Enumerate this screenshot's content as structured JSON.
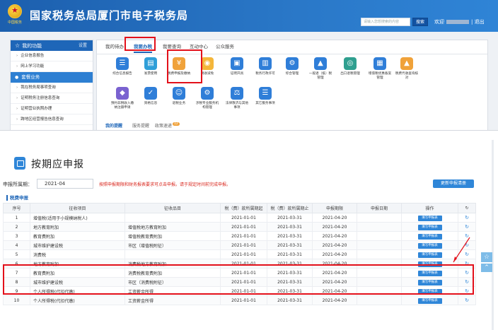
{
  "header": {
    "emblem_text": "中国税务",
    "title": "国家税务总局厦门市电子税务局",
    "search_placeholder": "请输入您想搜索的内容",
    "search_button": "搜索",
    "welcome": "欢迎",
    "logout": "| 退出"
  },
  "sidebar": {
    "head": "我的功能",
    "set": "设置",
    "items_top": [
      "企业信息报告",
      "网上学习功能"
    ],
    "active": "套餐业务",
    "items_bottom": [
      "我在税务局事项查询",
      "证明税务注册信息查询",
      "证明营业执照办理",
      "跨地区经营报告信息查询"
    ]
  },
  "tabs": [
    "我的待办",
    "我要办税",
    "我要查询",
    "互动中心",
    "公众服务"
  ],
  "icons": [
    {
      "label": "综合信息报告",
      "glyph": "☰",
      "color": "#2f7ed8"
    },
    {
      "label": "发票使用",
      "glyph": "▤",
      "color": "#2f9fd8"
    },
    {
      "label": "税费申报及缴纳",
      "glyph": "¥",
      "color": "#f0a23a"
    },
    {
      "label": "税收减免",
      "glyph": "◉",
      "color": "#f4b63a"
    },
    {
      "label": "证明开具",
      "glyph": "▣",
      "color": "#2f7ed8"
    },
    {
      "label": "税务行政许可",
      "glyph": "▥",
      "color": "#2f7ed8"
    },
    {
      "label": "综合管理",
      "glyph": "⚙",
      "color": "#2f7ed8"
    },
    {
      "label": "一般退（抵）税管理",
      "glyph": "▲",
      "color": "#2f7ed8"
    },
    {
      "label": "出口退税管理",
      "glyph": "◎",
      "color": "#2f9f8f"
    },
    {
      "label": "增值税优惠备案管理",
      "glyph": "▦",
      "color": "#2f7ed8"
    },
    {
      "label": "税费代收查询核对",
      "glyph": "▲",
      "color": "#f0a23a"
    },
    {
      "label": "预约非税收入缴纳注册申请",
      "glyph": "◆",
      "color": "#7a62d0"
    },
    {
      "label": "资格信息",
      "glyph": "✓",
      "color": "#2f7ed8"
    },
    {
      "label": "退税业务",
      "glyph": "☺",
      "color": "#2f7ed8"
    },
    {
      "label": "涉税专业服务机构管理",
      "glyph": "⚙",
      "color": "#2f7ed8"
    },
    {
      "label": "法律救济与其他事项",
      "glyph": "⚖",
      "color": "#2f7ed8"
    },
    {
      "label": "其它服务事项",
      "glyph": "☰",
      "color": "#2f7ed8"
    }
  ],
  "panel_footer": {
    "links": [
      "我的提醒",
      "服务提醒",
      "政策速递"
    ],
    "count": "12"
  },
  "page": {
    "title": "按期应申报",
    "period_label": "申报所属期：",
    "period_value": "2021-04",
    "notice": "按照申报期限和财务报表要求可点击申报。请于规定时间前完成申报。",
    "refresh_button": "更新申报清册",
    "section_title": "税费申报"
  },
  "table": {
    "columns": [
      "序号",
      "征收项目",
      "征收品目",
      "税（费）款所属期起",
      "税（费）款所属期止",
      "申报期限",
      "申报日期",
      "操作",
      "↻"
    ],
    "rows": [
      [
        "1",
        "增值税(适用于小规模纳税人)",
        "",
        "2021-01-01",
        "2021-03-31",
        "2021-04-20",
        "",
        "填写申报表",
        "↻"
      ],
      [
        "2",
        "地方教育附加",
        "增值税地方教育附加",
        "2021-01-01",
        "2021-03-31",
        "2021-04-20",
        "",
        "填写申报表",
        "↻"
      ],
      [
        "3",
        "教育费附加",
        "增值税教育费附加",
        "2021-01-01",
        "2021-03-31",
        "2021-04-20",
        "",
        "填写申报表",
        "↻"
      ],
      [
        "4",
        "城市维护建设税",
        "市区（增值税附征）",
        "2021-01-01",
        "2021-03-31",
        "2021-04-20",
        "",
        "填写申报表",
        "↻"
      ],
      [
        "5",
        "消费税",
        "",
        "2021-01-01",
        "2021-03-31",
        "2021-04-20",
        "",
        "填写申报表",
        "↻"
      ],
      [
        "6",
        "地方教育附加",
        "消费税地方教育附加",
        "2021-01-01",
        "2021-03-31",
        "2021-04-20",
        "",
        "填写申报表",
        "↻"
      ],
      [
        "7",
        "教育费附加",
        "消费税教育费附加",
        "2021-01-01",
        "2021-03-31",
        "2021-04-20",
        "",
        "填写申报表",
        "↻"
      ],
      [
        "8",
        "城市维护建设税",
        "市区（消费税附征）",
        "2021-01-01",
        "2021-03-31",
        "2021-04-20",
        "",
        "填写申报表",
        "↻"
      ],
      [
        "9",
        "个人所得税(代扣代缴)",
        "工资薪金所得",
        "2021-01-01",
        "2021-03-31",
        "2021-04-20",
        "",
        "填写申报表",
        "↻"
      ],
      [
        "10",
        "个人所得税(代扣代缴)",
        "工资薪金所得",
        "2021-01-01",
        "2021-03-31",
        "2021-04-20",
        "",
        "填写申报表",
        "↻"
      ]
    ]
  },
  "colors": {
    "header_blue": "#1c5fae",
    "accent": "#2f86d8",
    "highlight_red": "#e3101a",
    "notice_red": "#d9261c"
  }
}
